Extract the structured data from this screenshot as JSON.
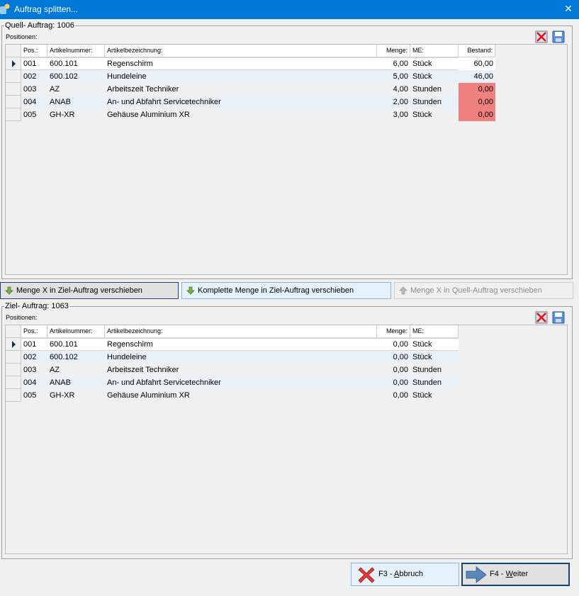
{
  "window": {
    "title": "Auftrag splitten...",
    "close_glyph": "✕"
  },
  "colors": {
    "accent": "#0078d7",
    "stock_warning": "#f08080",
    "selected_row": "#ffffff",
    "row_odd": "#e8f0f8",
    "row_even": "#f0f0f0"
  },
  "source": {
    "title": "Quell- Auftrag: 1006",
    "positions_label": "Positionen:",
    "icons": [
      "delete-row-icon",
      "save-icon"
    ],
    "columns": [
      "Pos.:",
      "Artikelnummer:",
      "Artikelbezeichnung:",
      "Menge:",
      "ME:",
      "Bestand:"
    ],
    "rows": [
      {
        "pos": "001",
        "artnr": "600.101",
        "bez": "Regenschirm",
        "menge": "6,00",
        "me": "Stück",
        "bestand": "60,00",
        "warn": false,
        "selected": true
      },
      {
        "pos": "002",
        "artnr": "600.102",
        "bez": "Hundeleine",
        "menge": "5,00",
        "me": "Stück",
        "bestand": "46,00",
        "warn": false,
        "selected": false
      },
      {
        "pos": "003",
        "artnr": "AZ",
        "bez": "Arbeitszeit Techniker",
        "menge": "4,00",
        "me": "Stunden",
        "bestand": "0,00",
        "warn": true,
        "selected": false
      },
      {
        "pos": "004",
        "artnr": "ANAB",
        "bez": "An- und Abfahrt Servicetechniker",
        "menge": "2,00",
        "me": "Stunden",
        "bestand": "0,00",
        "warn": true,
        "selected": false
      },
      {
        "pos": "005",
        "artnr": "GH-XR",
        "bez": "Gehäuse Aluminium XR",
        "menge": "3,00",
        "me": "Stück",
        "bestand": "0,00",
        "warn": true,
        "selected": false
      }
    ]
  },
  "actions": {
    "move_x_to_target": "Menge X in Ziel-Auftrag verschieben",
    "move_all_to_target": "Komplette Menge in Ziel-Auftrag verschieben",
    "move_x_to_source": "Menge X in Quell-Auftrag verschieben"
  },
  "target": {
    "title": "Ziel- Auftrag: 1063",
    "positions_label": "Positionen:",
    "icons": [
      "delete-row-icon",
      "save-icon"
    ],
    "columns": [
      "Pos.:",
      "Artikelnummer:",
      "Artikelbezeichnung:",
      "Menge:",
      "ME:"
    ],
    "rows": [
      {
        "pos": "001",
        "artnr": "600.101",
        "bez": "Regenschirm",
        "menge": "0,00",
        "me": "Stück",
        "selected": true
      },
      {
        "pos": "002",
        "artnr": "600.102",
        "bez": "Hundeleine",
        "menge": "0,00",
        "me": "Stück",
        "selected": false
      },
      {
        "pos": "003",
        "artnr": "AZ",
        "bez": "Arbeitszeit Techniker",
        "menge": "0,00",
        "me": "Stunden",
        "selected": false
      },
      {
        "pos": "004",
        "artnr": "ANAB",
        "bez": "An- und Abfahrt Servicetechniker",
        "menge": "0,00",
        "me": "Stunden",
        "selected": false
      },
      {
        "pos": "005",
        "artnr": "GH-XR",
        "bez": "Gehäuse Aluminium XR",
        "menge": "0,00",
        "me": "Stück",
        "selected": false
      }
    ]
  },
  "footer": {
    "cancel": {
      "key": "F3 - ",
      "mnemonic": "A",
      "rest": "bbruch"
    },
    "next": {
      "key": "F4 - ",
      "mnemonic": "W",
      "rest": "eiter"
    }
  }
}
